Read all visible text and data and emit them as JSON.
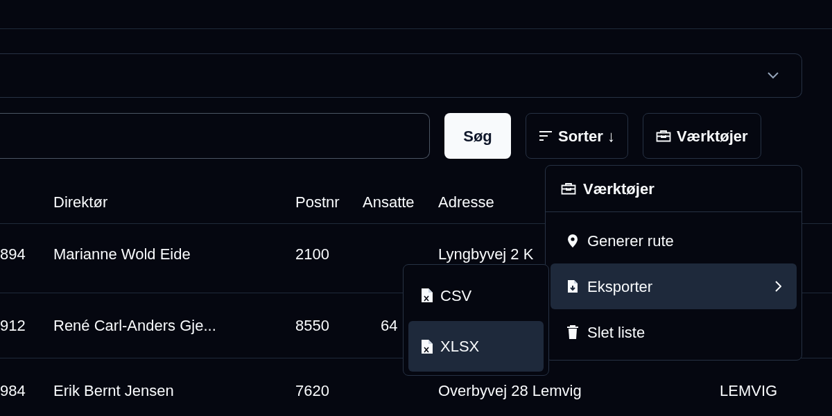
{
  "toolbar": {
    "search_button": "Søg",
    "sort_button": {
      "label": "Sorter",
      "arrow": "↓"
    },
    "tools_button": "Værktøjer"
  },
  "table": {
    "columns": [
      null,
      "Direktør",
      "Postnr",
      "Ansatte",
      "Adresse",
      null
    ],
    "rows": [
      [
        "894",
        "Marianne Wold Eide",
        "2100",
        null,
        "Lyngbyvej 2 K",
        null
      ],
      [
        "912",
        "René Carl-Anders Gje...",
        "8550",
        "64",
        null,
        null
      ],
      [
        "984",
        "Erik Bernt Jensen",
        "7620",
        null,
        "Overbyvej 28 Lemvig",
        "LEMVIG"
      ]
    ]
  },
  "tools_menu": {
    "title": "Værktøjer",
    "items": [
      {
        "label": "Generer rute",
        "kind": "route",
        "selected": false,
        "has_submenu": false
      },
      {
        "label": "Eksporter",
        "kind": "export",
        "selected": true,
        "has_submenu": true
      },
      {
        "label": "Slet liste",
        "kind": "delete",
        "selected": false,
        "has_submenu": false
      }
    ]
  },
  "export_menu": {
    "items": [
      {
        "label": "CSV",
        "selected": false
      },
      {
        "label": "XLSX",
        "selected": true
      }
    ]
  }
}
